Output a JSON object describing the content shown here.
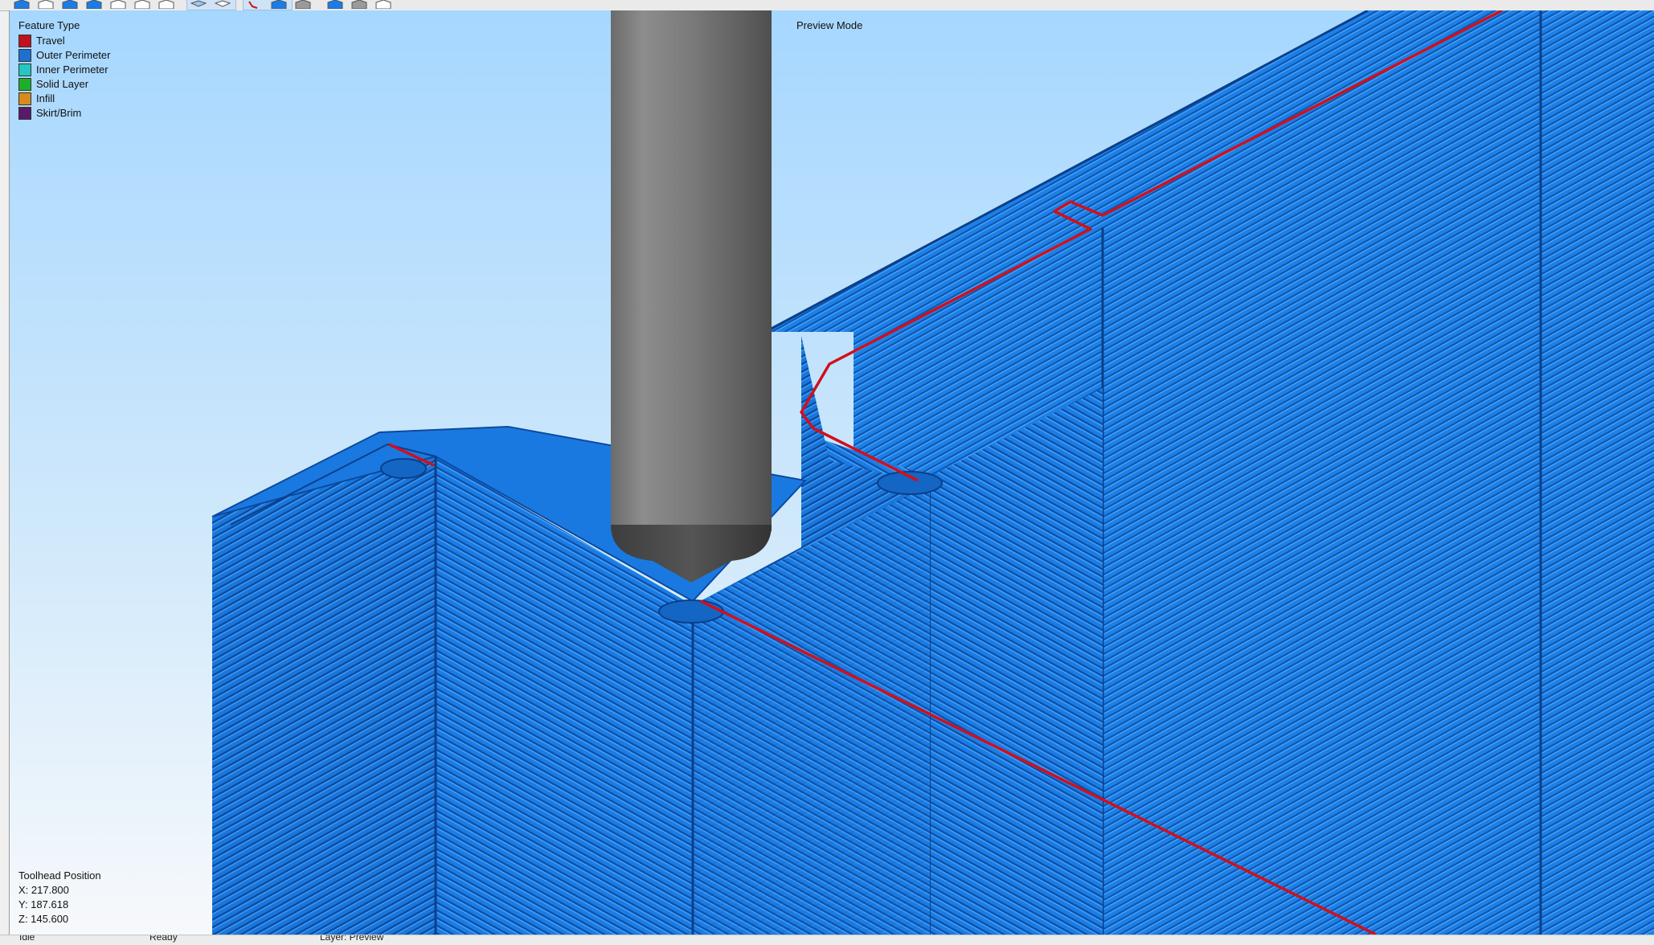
{
  "toolbar": {
    "buttons": [
      {
        "name": "view-iso-button",
        "icon": "cube-solid-icon"
      },
      {
        "name": "view-front-button",
        "icon": "cube-outline-icon"
      },
      {
        "name": "view-back-button",
        "icon": "cube-solid-icon"
      },
      {
        "name": "view-left-button",
        "icon": "cube-solid-icon"
      },
      {
        "name": "view-right-button",
        "icon": "cube-outline-icon"
      },
      {
        "name": "view-top-button",
        "icon": "cube-outline-icon"
      },
      {
        "name": "view-bottom-button",
        "icon": "cube-outline-icon"
      },
      {
        "name": "perspective-button",
        "icon": "perspective-icon"
      },
      {
        "name": "orthographic-button",
        "icon": "orthographic-icon"
      },
      {
        "name": "show-travel-button",
        "icon": "travel-icon"
      },
      {
        "name": "shaded-view-button",
        "icon": "shaded-icon"
      },
      {
        "name": "wireframe-view-button",
        "icon": "wireframe-icon"
      },
      {
        "name": "show-model-button",
        "icon": "model-icon"
      },
      {
        "name": "show-bed-button",
        "icon": "bed-icon"
      },
      {
        "name": "show-extruder-button",
        "icon": "extruder-icon"
      }
    ]
  },
  "legend": {
    "title": "Feature Type",
    "items": [
      {
        "label": "Travel",
        "color": "#c0111f"
      },
      {
        "label": "Outer Perimeter",
        "color": "#1f6fd0"
      },
      {
        "label": "Inner Perimeter",
        "color": "#25c6c0"
      },
      {
        "label": "Solid Layer",
        "color": "#1fae2a"
      },
      {
        "label": "Infill",
        "color": "#d98a1c"
      },
      {
        "label": "Skirt/Brim",
        "color": "#5a1a6a"
      }
    ]
  },
  "preview_mode": "Preview Mode",
  "toolhead": {
    "title": "Toolhead Position",
    "x": "X: 217.800",
    "y": "Y: 187.618",
    "z": "Z: 145.600"
  },
  "statusbar": {
    "left": "Idle",
    "middle": "Ready",
    "right": "Layer: Preview"
  },
  "colors": {
    "print_blue": "#1a7de6",
    "travel_red": "#d0101c",
    "nozzle_gray": "#7a7a7a",
    "sky_top": "#a8d8ff",
    "sky_bottom": "#f6f9fc"
  }
}
